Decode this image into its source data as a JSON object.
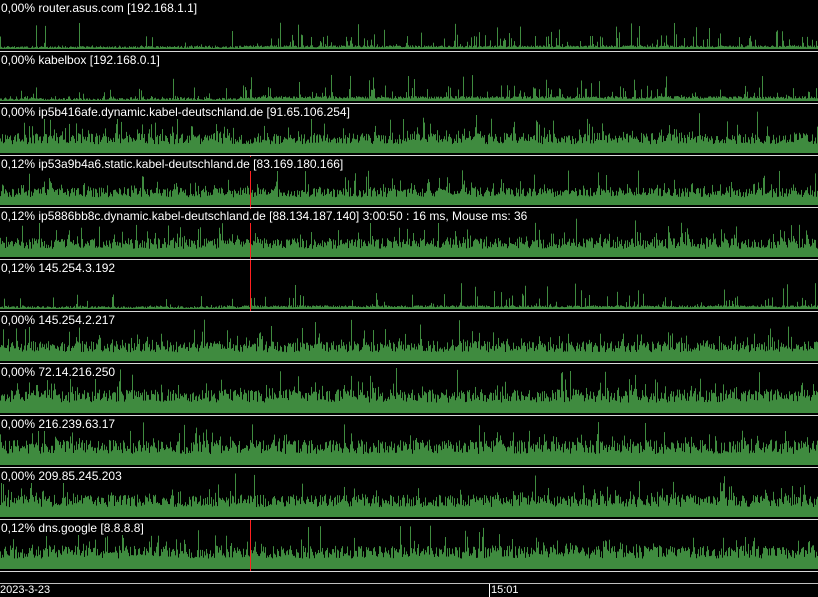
{
  "colors": {
    "graph": "#3f8b3f",
    "cursor": "#ff2020",
    "separator": "#d9d9d9",
    "background": "#000000"
  },
  "panels": [
    {
      "label": "0,00% router.asus.com [192.168.1.1]",
      "level": 0.05,
      "cursor": false
    },
    {
      "label": "0,00% kabelbox [192.168.0.1]",
      "level": 0.08,
      "cursor": false
    },
    {
      "label": "0,00% ip5b416afe.dynamic.kabel-deutschland.de [91.65.106.254]",
      "level": 0.32,
      "cursor": false
    },
    {
      "label": "0,12% ip53a9b4a6.static.kabel-deutschland.de [83.169.180.166]",
      "level": 0.28,
      "cursor": true
    },
    {
      "label": "0,12% ip5886bb8c.dynamic.kabel-deutschland.de [88.134.187.140] 3:00:50 : 16 ms, Mouse ms: 36",
      "level": 0.3,
      "cursor": true
    },
    {
      "label": "0,12% 145.254.3.192",
      "level": 0.05,
      "cursor": true
    },
    {
      "label": "0,00% 145.254.2.217",
      "level": 0.32,
      "cursor": false
    },
    {
      "label": "0,00% 72.14.216.250",
      "level": 0.38,
      "cursor": false
    },
    {
      "label": "0,00% 216.239.63.17",
      "level": 0.4,
      "cursor": false
    },
    {
      "label": "0,00% 209.85.245.203",
      "level": 0.36,
      "cursor": false
    },
    {
      "label": "0,12% dns.google [8.8.8.8]",
      "level": 0.38,
      "cursor": true
    }
  ],
  "timeline": {
    "date": "2023-3-23",
    "time": "15:01"
  }
}
